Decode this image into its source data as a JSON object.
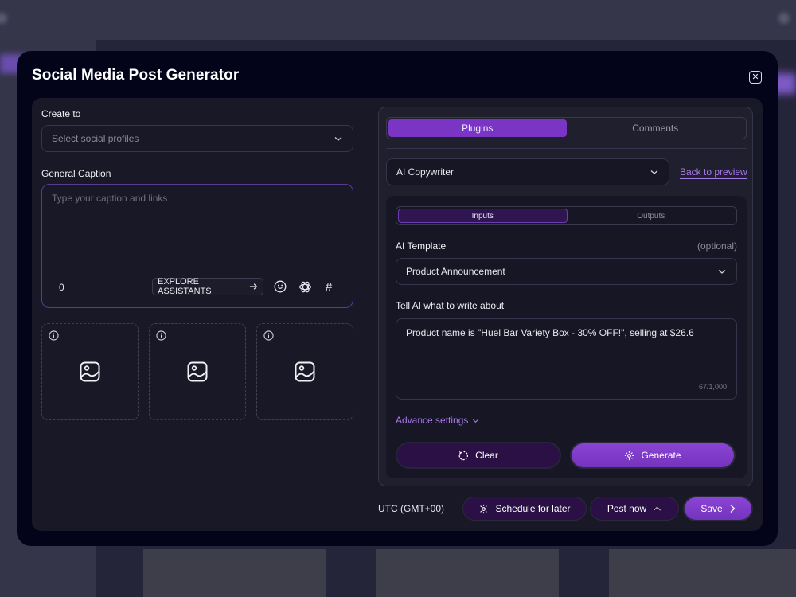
{
  "modal": {
    "title": "Social Media Post Generator",
    "close_icon": "close-icon"
  },
  "left": {
    "create_to_label": "Create to",
    "profiles_placeholder": "Select social profiles",
    "caption_label": "General Caption",
    "caption_placeholder": "Type your caption and links",
    "caption_count": "0",
    "explore_label": "EXPLORE ASSISTANTS",
    "tools": [
      "emoji-icon",
      "openai-icon",
      "hashtag-icon"
    ],
    "media_slots": [
      {
        "icon": "image-icon",
        "info_icon": "info-icon"
      },
      {
        "icon": "image-icon",
        "info_icon": "info-icon"
      },
      {
        "icon": "image-icon",
        "info_icon": "info-icon"
      }
    ]
  },
  "right": {
    "tabs": [
      {
        "label": "Plugins",
        "active": true
      },
      {
        "label": "Comments",
        "active": false
      }
    ],
    "plugin_select": "AI Copywriter",
    "back_link": "Back to preview",
    "subtabs": [
      {
        "label": "Inputs",
        "active": true
      },
      {
        "label": "Outputs",
        "active": false
      }
    ],
    "template_label": "AI Template",
    "template_optional": "(optional)",
    "template_value": "Product Announcement",
    "prompt_label": "Tell AI what to write about",
    "prompt_value": "Product name is \"Huel Bar Variety Box - 30% OFF!\", selling at $26.6",
    "prompt_count": "67/1,000",
    "advance_label": "Advance settings",
    "clear_label": "Clear",
    "generate_label": "Generate"
  },
  "footer": {
    "timezone": "UTC (GMT+00)",
    "schedule_label": "Schedule for later",
    "post_now_label": "Post now",
    "save_label": "Save"
  },
  "colors": {
    "accent": "#7a35c4",
    "accent_dark": "#2b1046",
    "link": "#a679e8",
    "modal_bg": "#03031a",
    "panel_bg": "#181826"
  }
}
